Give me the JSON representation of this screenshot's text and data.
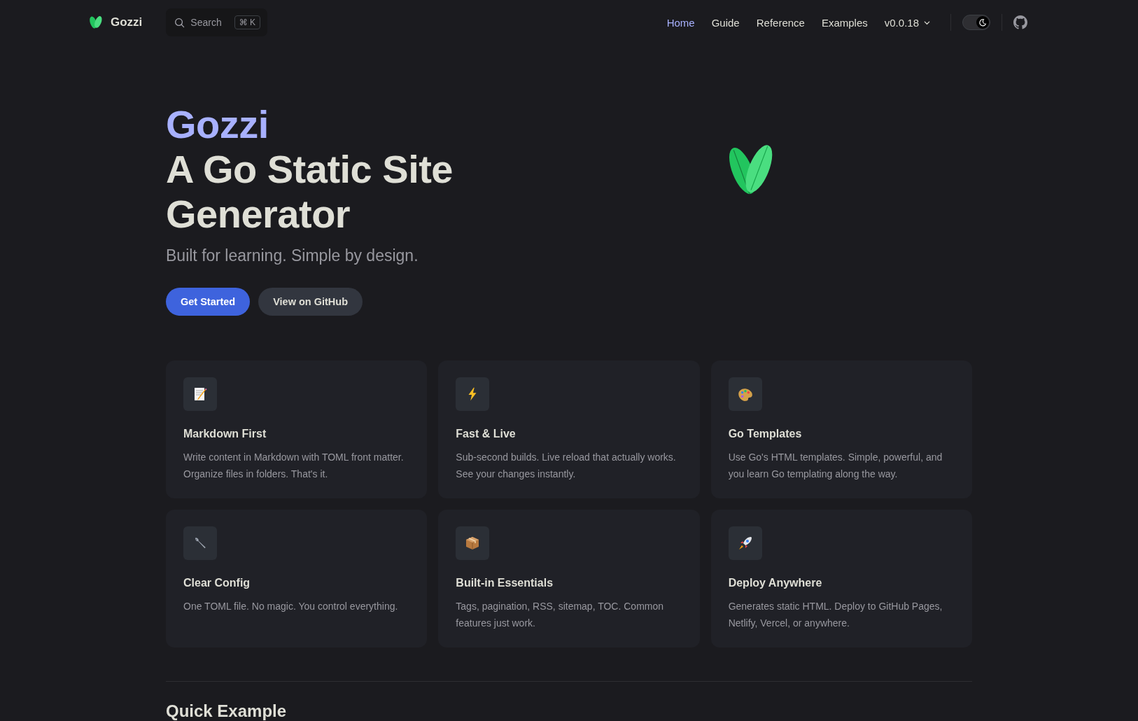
{
  "brand": {
    "name": "Gozzi"
  },
  "search": {
    "placeholder": "Search",
    "shortcut": "⌘ K"
  },
  "nav": [
    {
      "label": "Home",
      "selected": true
    },
    {
      "label": "Guide",
      "selected": false
    },
    {
      "label": "Reference",
      "selected": false
    },
    {
      "label": "Examples",
      "selected": false
    }
  ],
  "version_menu": {
    "label": "v0.0.18"
  },
  "appearance_switch": {
    "checked": true
  },
  "hero": {
    "name": "Gozzi",
    "title": "A Go Static Site Generator",
    "tagline": "Built for learning. Simple by design.",
    "actions": [
      {
        "label": "Get Started",
        "kind": "brand"
      },
      {
        "label": "View on GitHub",
        "kind": "alt"
      }
    ]
  },
  "features": [
    {
      "title": "Markdown First",
      "details": "Write content in Markdown with TOML front matter. Organize files in folders. That's it."
    },
    {
      "title": "Fast & Live",
      "details": "Sub-second builds. Live reload that actually works. See your changes instantly."
    },
    {
      "title": "Go Templates",
      "details": "Use Go's HTML templates. Simple, powerful, and you learn Go templating along the way."
    },
    {
      "title": "Clear Config",
      "details": "One TOML file. No magic. You control everything."
    },
    {
      "title": "Built-in Essentials",
      "details": "Tags, pagination, RSS, sitemap, TOC. Common features just work."
    },
    {
      "title": "Deploy Anywhere",
      "details": "Generates static HTML. Deploy to GitHub Pages, Netlify, Vercel, or anywhere."
    }
  ],
  "section": {
    "heading": "Quick Example"
  }
}
